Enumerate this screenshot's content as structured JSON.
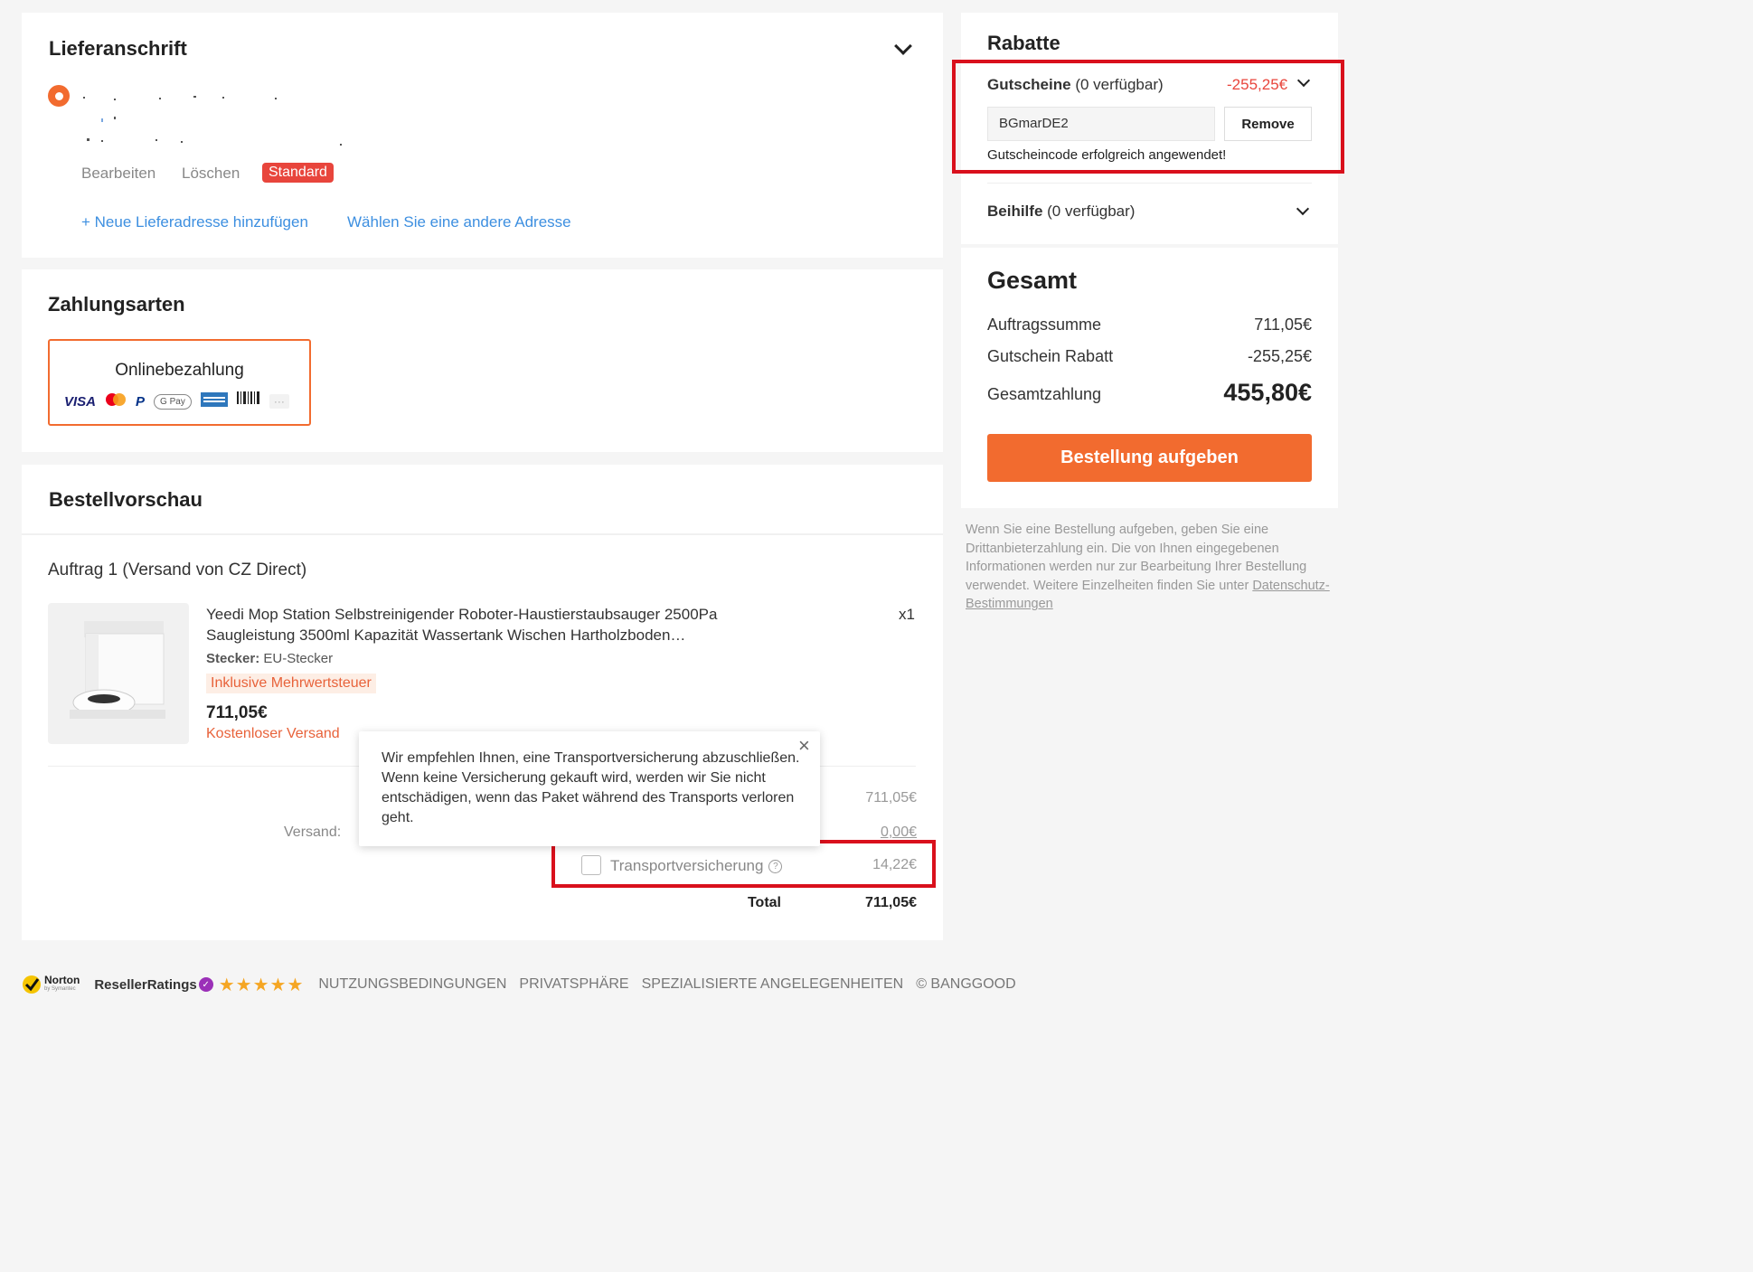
{
  "address": {
    "title": "Lieferanschrift",
    "edit": "Bearbeiten",
    "delete": "Löschen",
    "default_badge": "Standard",
    "add_new": "+ Neue Lieferadresse hinzufügen",
    "choose_other": "Wählen Sie eine andere Adresse"
  },
  "payment": {
    "title": "Zahlungsarten",
    "method": "Onlinebezahlung",
    "icons": [
      "VISA",
      "mastercard",
      "paypal",
      "G Pay",
      "amex",
      "boleto",
      "more"
    ]
  },
  "order": {
    "title": "Bestellvorschau",
    "subtitle": "Auftrag 1 (Versand von CZ Direct)",
    "product_name": "Yeedi Mop Station Selbstreinigender Roboter-Haustierstaubsauger 2500Pa Saugleistung 3500ml Kapazität Wassertank Wischen Hartholzboden…",
    "qty": "x1",
    "plug_label": "Stecker:",
    "plug_value": "EU-Stecker",
    "vat_tag": "Inklusive Mehrwertsteuer",
    "price": "711,05€",
    "shipping_note": "Kostenloser Versand",
    "subtotal_value": "711,05€",
    "shipping_label": "Versand:",
    "shipping_value": "0,00€",
    "insurance_label": "Transportversicherung",
    "insurance_value": "14,22€",
    "total_label": "Total",
    "total_value": "711,05€",
    "tooltip_text": "Wir empfehlen Ihnen, eine Transportversicherung abzuschließen. Wenn keine Versicherung gekauft wird, werden wir Sie nicht entschädigen, wenn das Paket während des Transports verloren geht."
  },
  "discounts": {
    "title": "Rabatte",
    "coupons_label": "Gutscheine",
    "coupons_count": "(0 verfügbar)",
    "coupons_value": "-255,25€",
    "code": "BGmarDE2",
    "remove": "Remove",
    "success": "Gutscheincode erfolgreich angewendet!",
    "allowance_label": "Beihilfe",
    "allowance_count": "(0 verfügbar)"
  },
  "summary": {
    "title": "Gesamt",
    "order_sum_label": "Auftragssumme",
    "order_sum_value": "711,05€",
    "coupon_label": "Gutschein Rabatt",
    "coupon_value": "-255,25€",
    "total_label": "Gesamtzahlung",
    "total_value": "455,80€",
    "place_order": "Bestellung aufgeben"
  },
  "disclaimer": {
    "text": "Wenn Sie eine Bestellung aufgeben, geben Sie eine Drittanbieterzahlung ein. Die von Ihnen eingegebenen Informationen werden nur zur Bearbeitung Ihrer Bestellung verwendet. Weitere Einzelheiten finden Sie unter",
    "link": "Datenschutz-Bestimmungen"
  },
  "footer": {
    "norton": "Norton",
    "norton_sub": "by Symantec",
    "reseller": "ResellerRatings",
    "stars": "★★★★★",
    "links": [
      "NUTZUNGSBEDINGUNGEN",
      "PRIVATSPHÄRE",
      "SPEZIALISIERTE ANGELEGENHEITEN",
      "© BANGGOOD"
    ]
  },
  "colors": {
    "accent": "#f26b2f",
    "highlight_box": "#d9101c",
    "link": "#3d8fe0",
    "discount": "#e8453c"
  }
}
